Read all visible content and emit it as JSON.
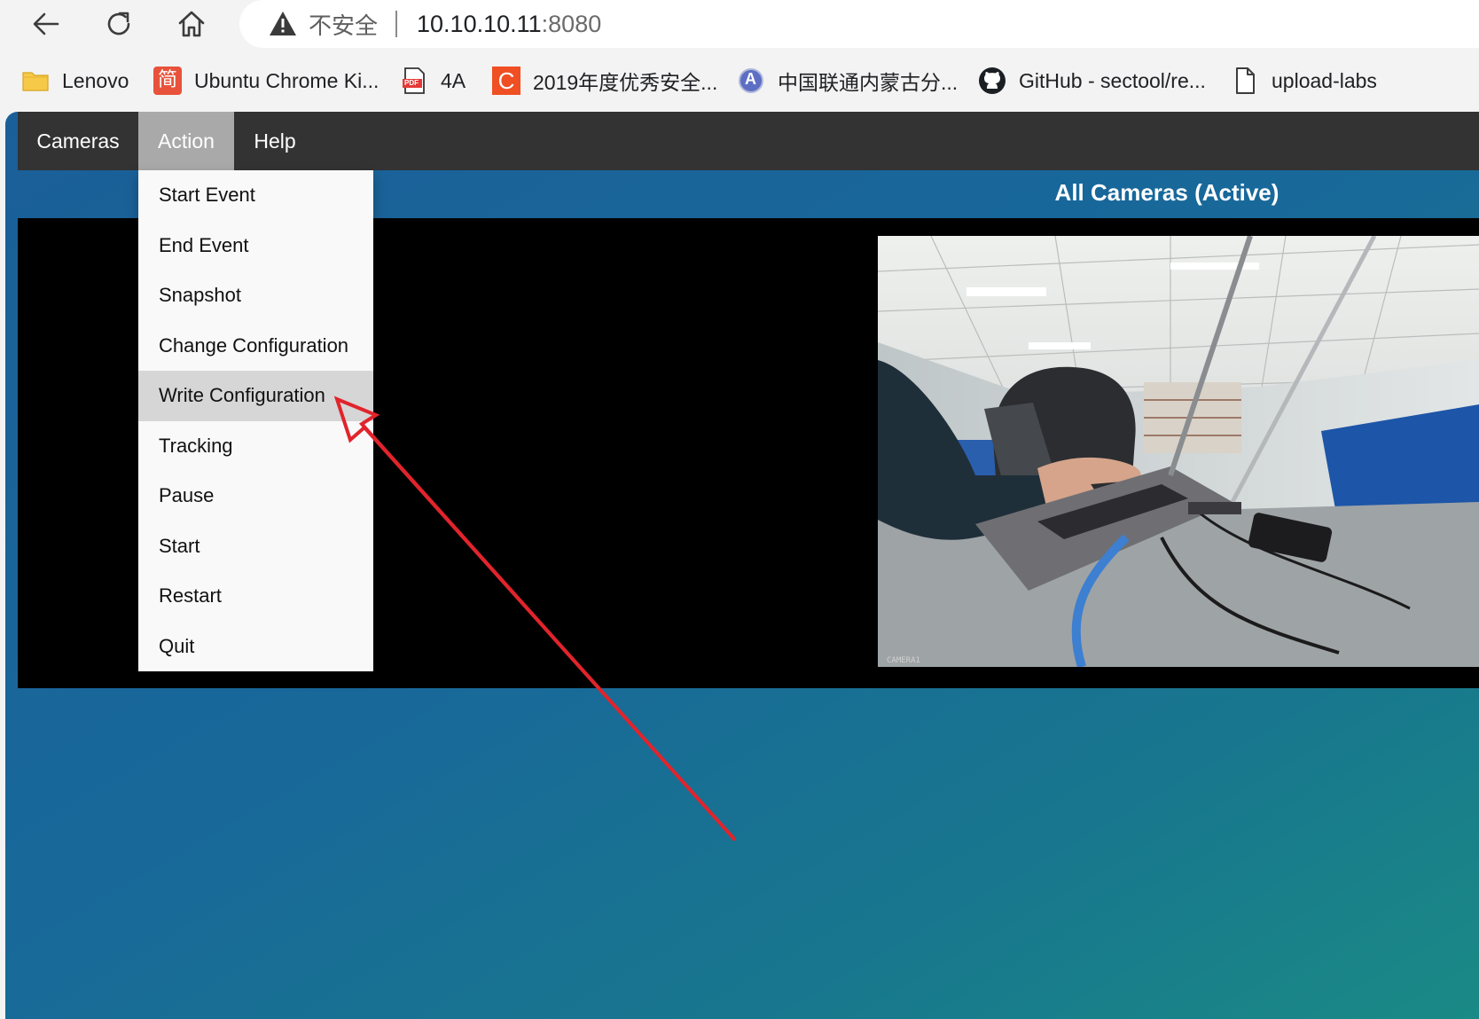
{
  "browser": {
    "security_label": "不安全",
    "url_host": "10.10.10.11",
    "url_port": ":8080"
  },
  "bookmarks": [
    {
      "label": "Lenovo",
      "icon": "folder-icon"
    },
    {
      "label": "Ubuntu Chrome Ki...",
      "icon": "jian-icon",
      "glyph": "简"
    },
    {
      "label": "4A",
      "icon": "pdf-icon",
      "glyph": "PDF"
    },
    {
      "label": "2019年度优秀安全...",
      "icon": "c-logo-icon",
      "glyph": "C"
    },
    {
      "label": "中国联通内蒙古分...",
      "icon": "a-badge-icon",
      "glyph": "A"
    },
    {
      "label": "GitHub - sectool/re...",
      "icon": "github-icon"
    },
    {
      "label": "upload-labs",
      "icon": "page-icon"
    }
  ],
  "menu": {
    "items": [
      {
        "label": "Cameras"
      },
      {
        "label": "Action"
      },
      {
        "label": "Help"
      }
    ]
  },
  "header": {
    "title": "All Cameras (Active)"
  },
  "action_menu": {
    "items": [
      {
        "label": "Start Event"
      },
      {
        "label": "End Event"
      },
      {
        "label": "Snapshot"
      },
      {
        "label": "Change Configuration"
      },
      {
        "label": "Write Configuration"
      },
      {
        "label": "Tracking"
      },
      {
        "label": "Pause"
      },
      {
        "label": "Start"
      },
      {
        "label": "Restart"
      },
      {
        "label": "Quit"
      }
    ]
  },
  "camera": {
    "overlay_label": "CAMERA1"
  },
  "colors": {
    "accent": "#e1242c",
    "menubar": "#333333",
    "menu_active": "#a9a9a9"
  }
}
